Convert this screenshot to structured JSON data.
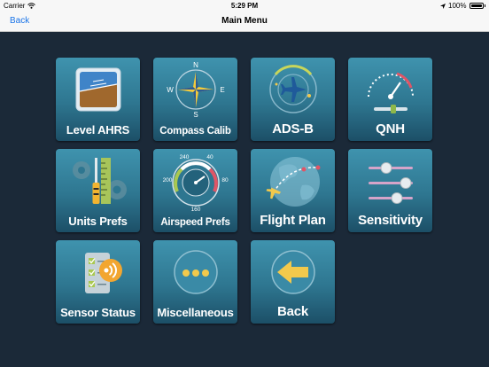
{
  "status_bar": {
    "carrier": "Carrier",
    "time": "5:29 PM",
    "battery": "100%"
  },
  "nav": {
    "back_label": "Back",
    "title": "Main Menu"
  },
  "tiles": [
    {
      "label": "Level AHRS",
      "icon": "attitude-indicator-icon"
    },
    {
      "label": "Compass Calib",
      "icon": "compass-rose-icon"
    },
    {
      "label": "ADS-B",
      "icon": "adsb-radar-icon"
    },
    {
      "label": "QNH",
      "icon": "altimeter-gauge-icon"
    },
    {
      "label": "Units Prefs",
      "icon": "ruler-screwdriver-icon"
    },
    {
      "label": "Airspeed Prefs",
      "icon": "airspeed-dial-icon"
    },
    {
      "label": "Flight Plan",
      "icon": "globe-plane-icon"
    },
    {
      "label": "Sensitivity",
      "icon": "slider-controls-icon"
    },
    {
      "label": "Sensor Status",
      "icon": "checklist-sensor-icon"
    },
    {
      "label": "Miscellaneous",
      "icon": "ellipsis-icon"
    },
    {
      "label": "Back",
      "icon": "back-arrow-icon"
    }
  ],
  "airspeed_dial": {
    "ticks": [
      "240",
      "40",
      "200",
      "80",
      "160"
    ]
  },
  "compass": {
    "north": "N",
    "east": "E",
    "south": "S",
    "west": "W"
  },
  "colors": {
    "background": "#1b2938",
    "tile_top": "#3f93ae",
    "tile_bottom": "#1c4f67",
    "nav_link": "#1a74e8"
  }
}
